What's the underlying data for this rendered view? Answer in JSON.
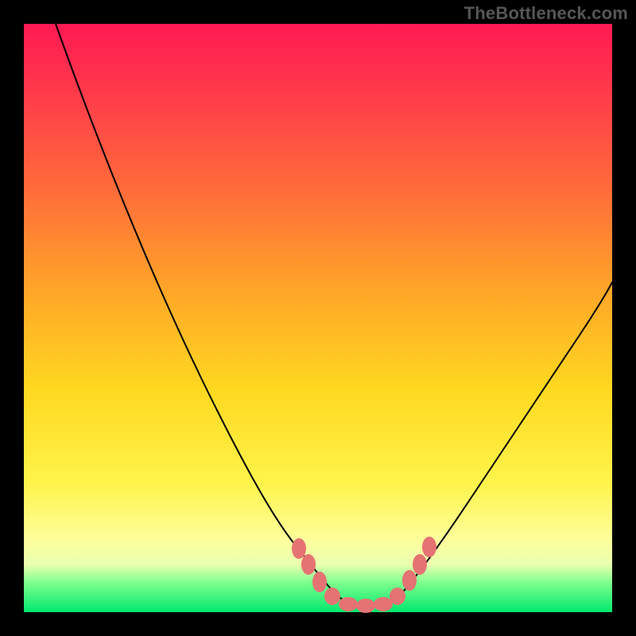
{
  "watermark": "TheBottleneck.com",
  "colors": {
    "frame": "#000000",
    "gradient_top": "#ff1a53",
    "gradient_bottom": "#00e86e",
    "curve": "#000000",
    "marker": "#e57373"
  },
  "chart_data": {
    "type": "line",
    "title": "",
    "xlabel": "",
    "ylabel": "",
    "xlim": [
      0,
      100
    ],
    "ylim": [
      0,
      100
    ],
    "x": [
      5,
      10,
      15,
      20,
      25,
      30,
      35,
      40,
      45,
      47,
      49,
      51,
      53,
      55,
      57,
      59,
      61,
      65,
      70,
      75,
      80,
      85,
      90,
      95,
      100
    ],
    "values": [
      100,
      90,
      80,
      70,
      59,
      48,
      37,
      26,
      14,
      10,
      6,
      3,
      1,
      0,
      0,
      1,
      3,
      8,
      15,
      23,
      31,
      39,
      47,
      54,
      60
    ],
    "markers": {
      "x": [
        44,
        45,
        47,
        49,
        52,
        55,
        58,
        60,
        62,
        63
      ],
      "y": [
        12,
        9,
        5,
        2,
        0.5,
        0.5,
        1,
        3,
        6,
        9
      ]
    }
  }
}
